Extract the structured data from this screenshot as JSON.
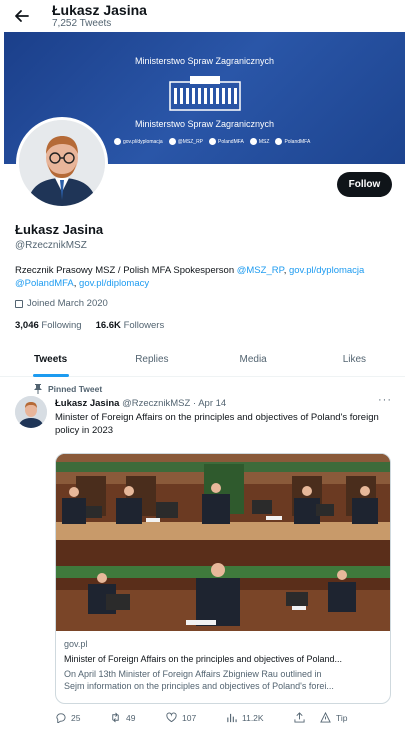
{
  "header": {
    "name": "Łukasz Jasina",
    "tweet_count": "7,252 Tweets"
  },
  "banner": {
    "title": "Ministerstwo Spraw Zagranicznych",
    "subtitle": "Ministerstwo Spraw Zagranicznych",
    "links": [
      "gov.pl/dyplomacja",
      "@MSZ_RP",
      "PolandMFA",
      "MSZ",
      "PolandMFA"
    ]
  },
  "profile": {
    "name": "Łukasz Jasina",
    "handle": "@RzecznikMSZ",
    "bio_text": "Rzecznik Prasowy MSZ / Polish MFA Spokesperson ",
    "bio_link1": "@MSZ_RP",
    "bio_link2": "gov.pl/dyplomacja",
    "bio_link3": "@PolandMFA",
    "bio_link4": "gov.pl/diplomacy",
    "joined": "Joined March 2020",
    "following_count": "3,046",
    "following_label": "Following",
    "followers_count": "16.6K",
    "followers_label": "Followers",
    "follow_button": "Follow"
  },
  "tabs": [
    "Tweets",
    "Replies",
    "Media",
    "Likes"
  ],
  "tweet": {
    "pinned_label": "Pinned Tweet",
    "author": "Łukasz Jasina",
    "handle_date": "@RzecznikMSZ · Apr 14",
    "more": "···",
    "text": "Minister of Foreign Affairs on the principles and objectives of Poland's foreign policy in 2023",
    "card": {
      "domain": "gov.pl",
      "title": "Minister of Foreign Affairs on the principles and objectives of Poland...",
      "desc_line1": "On April 13th Minister of Foreign Affairs Zbigniew Rau outlined in",
      "desc_line2": "Sejm information on the principles and objectives of Poland's forei..."
    },
    "actions": {
      "replies": "25",
      "retweets": "49",
      "likes": "107",
      "views": "11.2K",
      "tip": "Tip"
    }
  },
  "colors": {
    "accent": "#1d9bf0",
    "banner": "#2a56a8",
    "text": "#0f1419",
    "muted": "#536471"
  }
}
